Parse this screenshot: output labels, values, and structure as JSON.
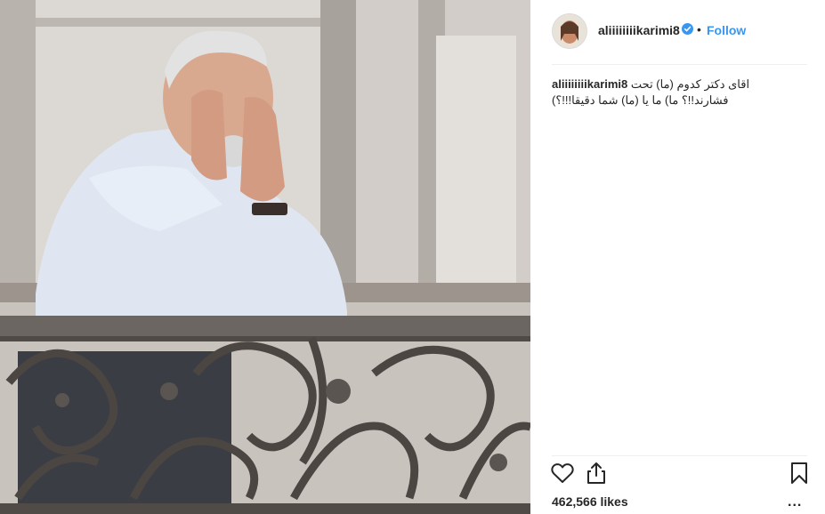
{
  "post": {
    "username": "aliiiiiiiikarimi8",
    "follow_label": "Follow",
    "separator": "•",
    "caption_username": "aliiiiiiiikarimi8",
    "caption_text": "اقای دکتر کدوم (ما) تحت فشارند!!؟ ما) ما یا (ما) شما دقیقا!!!؟)",
    "likes": "462,566 likes",
    "more": "..."
  },
  "colors": {
    "follow_blue": "#3897f0",
    "verified_blue": "#3897f0",
    "divider": "#efefef"
  },
  "icons": [
    "heart-icon",
    "share-icon",
    "bookmark-icon",
    "verified-badge-icon"
  ]
}
